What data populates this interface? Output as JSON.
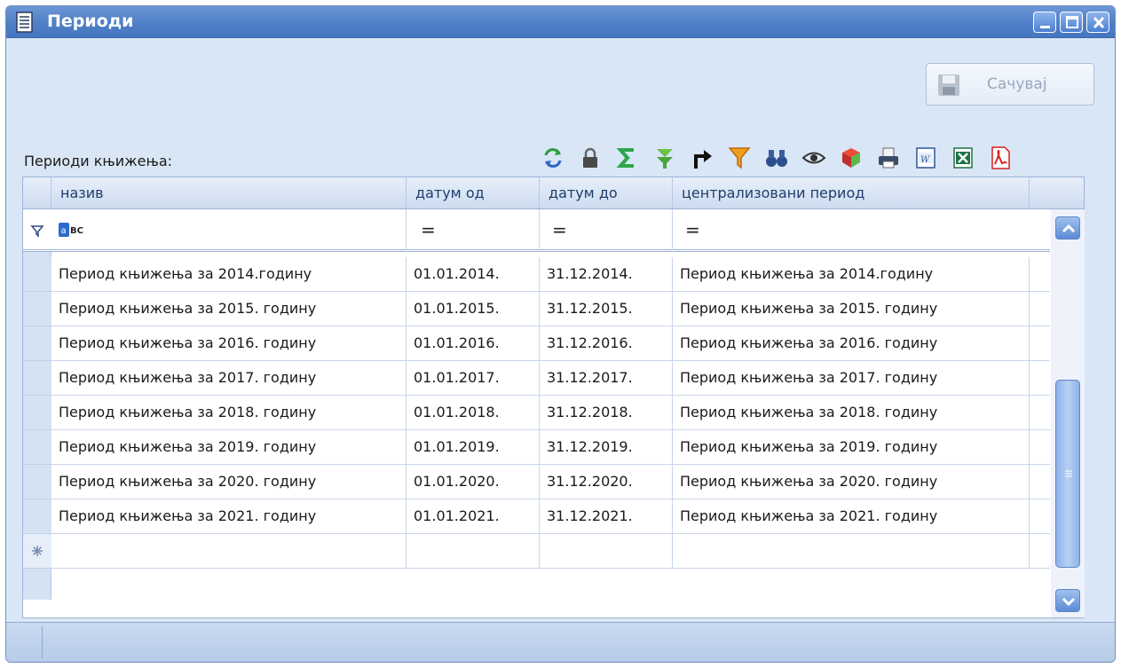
{
  "window": {
    "title": "Периоди",
    "controls": [
      "minimize",
      "maximize",
      "close"
    ]
  },
  "toolbar_top": {
    "save_label": "Сачувај",
    "save_icon": "floppy-disk-icon"
  },
  "grid_section": {
    "label": "Периоди књижења:",
    "toolbar_icons": [
      "refresh-icon",
      "lock-icon",
      "sum-icon",
      "expand-icon",
      "redirect-icon",
      "filter-icon",
      "find-icon",
      "view-icon",
      "layout-icon",
      "print-icon",
      "word-export-icon",
      "excel-export-icon",
      "pdf-export-icon"
    ]
  },
  "table": {
    "columns": [
      "назив",
      "датум од",
      "датум до",
      "централизовани период"
    ],
    "filter": {
      "text_operator_icon": "abc-filter-icon",
      "eq_symbols": [
        "=",
        "=",
        "="
      ]
    },
    "rows": [
      [
        "Период књижења за 2014.годину",
        "01.01.2014.",
        "31.12.2014.",
        "Период књижења за 2014.годину"
      ],
      [
        "Период књижења за 2015. годину",
        "01.01.2015.",
        "31.12.2015.",
        "Период књижења за 2015. годину"
      ],
      [
        "Период књижења за 2016. годину",
        "01.01.2016.",
        "31.12.2016.",
        "Период књижења за 2016. годину"
      ],
      [
        "Период књижења за 2017. годину",
        "01.01.2017.",
        "31.12.2017.",
        "Период књижења за 2017. годину"
      ],
      [
        "Период књижења за 2018. годину",
        "01.01.2018.",
        "31.12.2018.",
        "Период књижења за 2018. годину"
      ],
      [
        "Период књижења за 2019. годину",
        "01.01.2019.",
        "31.12.2019.",
        "Период књижења за 2019. годину"
      ],
      [
        "Период књижења за 2020. годину",
        "01.01.2020.",
        "31.12.2020.",
        "Период књижења за 2020. годину"
      ],
      [
        "Период књижења за 2021. годину",
        "01.01.2021.",
        "31.12.2021.",
        "Период књижења за 2021. годину"
      ]
    ],
    "new_row_icon": "new-row-asterisk-icon"
  },
  "colors": {
    "title_bar": "#4f7fc6",
    "window_bg": "#d9e6f5",
    "header_text": "#1f3d6b"
  }
}
